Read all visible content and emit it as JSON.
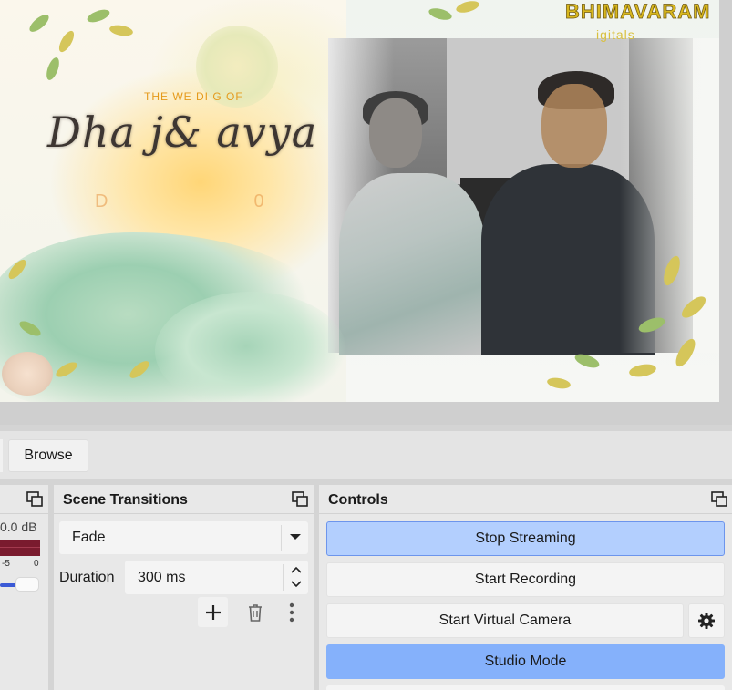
{
  "preview": {
    "wedding_line": "THE WE DI G OF",
    "names": "Dha  j&      avya",
    "date_text": "D0",
    "brand_name": "BHIMAVARAM",
    "brand_sub": "igitals"
  },
  "toolbar": {
    "browse_label": "Browse"
  },
  "audio_mixer": {
    "db_readout": "0.0 dB",
    "meter_tick_a": "-5",
    "meter_tick_b": "0",
    "volume_level": 0.55
  },
  "scene_transitions": {
    "title": "Scene Transitions",
    "selected_transition": "Fade",
    "duration_label": "Duration",
    "duration_value": "300 ms"
  },
  "controls": {
    "title": "Controls",
    "stop_streaming": "Stop Streaming",
    "start_recording": "Start Recording",
    "start_virtual_camera": "Start Virtual Camera",
    "studio_mode": "Studio Mode"
  },
  "colors": {
    "streaming_active": "#b3cffe",
    "studio_mode_active": "#85b1fb",
    "volume_accent": "#3b5ad6",
    "meter_fill": "#7a1b2e"
  },
  "icons": {
    "dock_float": "undock-icon",
    "dropdown": "chevron-down-icon",
    "add": "plus-icon",
    "remove": "trash-icon",
    "menu": "kebab-menu-icon",
    "settings": "gear-icon"
  }
}
